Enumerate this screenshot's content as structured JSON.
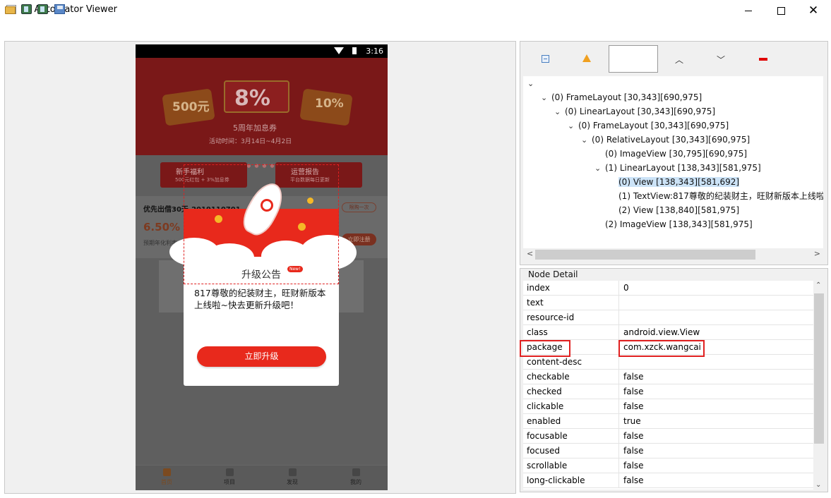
{
  "window": {
    "title": "UI Automator Viewer"
  },
  "device": {
    "time": "3:16",
    "banner": {
      "big": "8%",
      "left_badge": "500元",
      "right_badge": "10%",
      "subtitle": "5周年加息券",
      "date": "活动时间：3月14日~4月2日"
    },
    "promos": [
      {
        "title": "新手福利",
        "sub": "500元红包 + 3%加息券"
      },
      {
        "title": "运营报告",
        "sub": "平台数据每日更新"
      }
    ],
    "product": {
      "title": "优先出借30天-2019110701",
      "rate": "6.50%",
      "subtitle": "预期年化利率",
      "tag": "限购一次",
      "button": "立即注册"
    },
    "dialog": {
      "heading": "升级公告",
      "badge": "New!",
      "message": "817尊敬的纪装财主，旺财新版本上线啦~快去更新升级吧！",
      "button": "立即升级"
    },
    "bottom_nav": [
      "首页",
      "项目",
      "发现",
      "我的"
    ]
  },
  "tree": {
    "root_arrow": "⌄",
    "nodes": [
      {
        "label": "(0) FrameLayout [30,343][690,975]",
        "depth": 1,
        "arrow": "⌄",
        "selected": false
      },
      {
        "label": "(0) LinearLayout [30,343][690,975]",
        "depth": 2,
        "arrow": "⌄",
        "selected": false
      },
      {
        "label": "(0) FrameLayout [30,343][690,975]",
        "depth": 3,
        "arrow": "⌄",
        "selected": false
      },
      {
        "label": "(0) RelativeLayout [30,343][690,975]",
        "depth": 4,
        "arrow": "⌄",
        "selected": false
      },
      {
        "label": "(0) ImageView [30,795][690,975]",
        "depth": 5,
        "arrow": "",
        "selected": false
      },
      {
        "label": "(1) LinearLayout [138,343][581,975]",
        "depth": 5,
        "arrow": "⌄",
        "selected": false
      },
      {
        "label": "(0) View [138,343][581,692]",
        "depth": 6,
        "arrow": "",
        "selected": true
      },
      {
        "label": "(1) TextView:817尊敬的纪装财主，旺财新版本上线啦",
        "depth": 6,
        "arrow": "",
        "selected": false
      },
      {
        "label": "(2) View [138,840][581,975]",
        "depth": 6,
        "arrow": "",
        "selected": false
      },
      {
        "label": "(2) ImageView [138,343][581,975]",
        "depth": 5,
        "arrow": "",
        "selected": false
      }
    ]
  },
  "node_detail": {
    "title": "Node Detail",
    "rows": [
      {
        "key": "index",
        "value": "0"
      },
      {
        "key": "text",
        "value": ""
      },
      {
        "key": "resource-id",
        "value": ""
      },
      {
        "key": "class",
        "value": "android.view.View"
      },
      {
        "key": "package",
        "value": "com.xzck.wangcai"
      },
      {
        "key": "content-desc",
        "value": ""
      },
      {
        "key": "checkable",
        "value": "false"
      },
      {
        "key": "checked",
        "value": "false"
      },
      {
        "key": "clickable",
        "value": "false"
      },
      {
        "key": "enabled",
        "value": "true"
      },
      {
        "key": "focusable",
        "value": "false"
      },
      {
        "key": "focused",
        "value": "false"
      },
      {
        "key": "scrollable",
        "value": "false"
      },
      {
        "key": "long-clickable",
        "value": "false"
      }
    ]
  },
  "colors": {
    "accent": "#e8291c",
    "highlight": "#e02020",
    "selection": "#cce3f7"
  },
  "icons": {
    "toolbar": [
      "open-folder-icon",
      "device-screenshot-icon",
      "device-screenshot-compressed-icon",
      "save-icon"
    ],
    "tree_toolbar": [
      "expand-all-icon",
      "warning-icon",
      "up-icon",
      "down-icon",
      "clear-icon"
    ]
  }
}
